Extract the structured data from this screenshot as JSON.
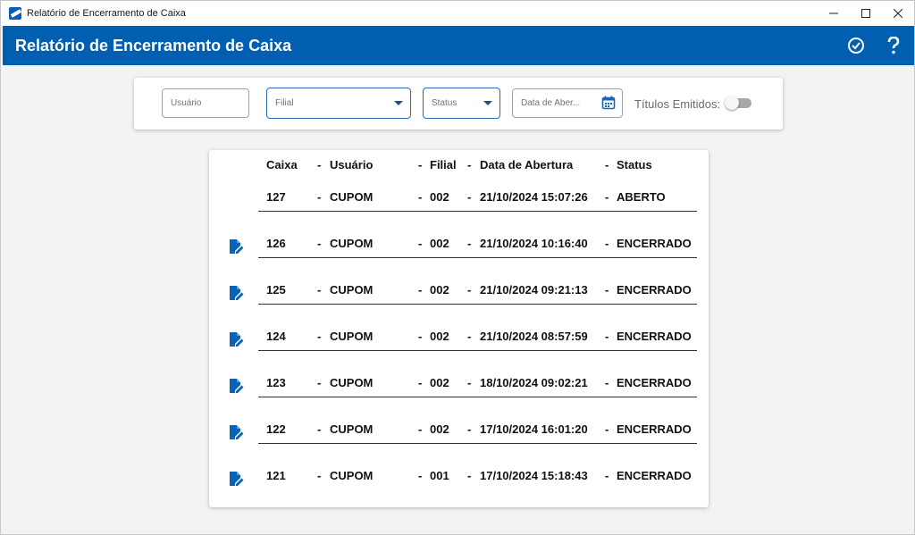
{
  "window": {
    "title": "Relatório de Encerramento de Caixa"
  },
  "header": {
    "title": "Relatório de Encerramento de Caixa"
  },
  "filters": {
    "usuario_placeholder": "Usuário",
    "filial_placeholder": "Filial",
    "status_placeholder": "Status",
    "data_placeholder": "Data de Aber...",
    "titulos_label": "Títulos Emitidos:",
    "titulos_checked": false
  },
  "table": {
    "headers": {
      "caixa": "Caixa",
      "usuario": "Usuário",
      "filial": "Filial",
      "data": "Data de Abertura",
      "status": "Status",
      "sep": "-"
    },
    "rows": [
      {
        "caixa": "127",
        "usuario": "CUPOM",
        "filial": "002",
        "data": "21/10/2024 15:07:26",
        "status": "ABERTO",
        "editable": false
      },
      {
        "caixa": "126",
        "usuario": "CUPOM",
        "filial": "002",
        "data": "21/10/2024 10:16:40",
        "status": "ENCERRADO",
        "editable": true
      },
      {
        "caixa": "125",
        "usuario": "CUPOM",
        "filial": "002",
        "data": "21/10/2024 09:21:13",
        "status": "ENCERRADO",
        "editable": true
      },
      {
        "caixa": "124",
        "usuario": "CUPOM",
        "filial": "002",
        "data": "21/10/2024 08:57:59",
        "status": "ENCERRADO",
        "editable": true
      },
      {
        "caixa": "123",
        "usuario": "CUPOM",
        "filial": "002",
        "data": "18/10/2024 09:02:21",
        "status": "ENCERRADO",
        "editable": true
      },
      {
        "caixa": "122",
        "usuario": "CUPOM",
        "filial": "002",
        "data": "17/10/2024 16:01:20",
        "status": "ENCERRADO",
        "editable": true
      },
      {
        "caixa": "121",
        "usuario": "CUPOM",
        "filial": "001",
        "data": "17/10/2024 15:18:43",
        "status": "ENCERRADO",
        "editable": true
      }
    ]
  },
  "colors": {
    "header_bg": "#005fb0",
    "accent": "#1565c0",
    "icon": "#0a63b5"
  }
}
